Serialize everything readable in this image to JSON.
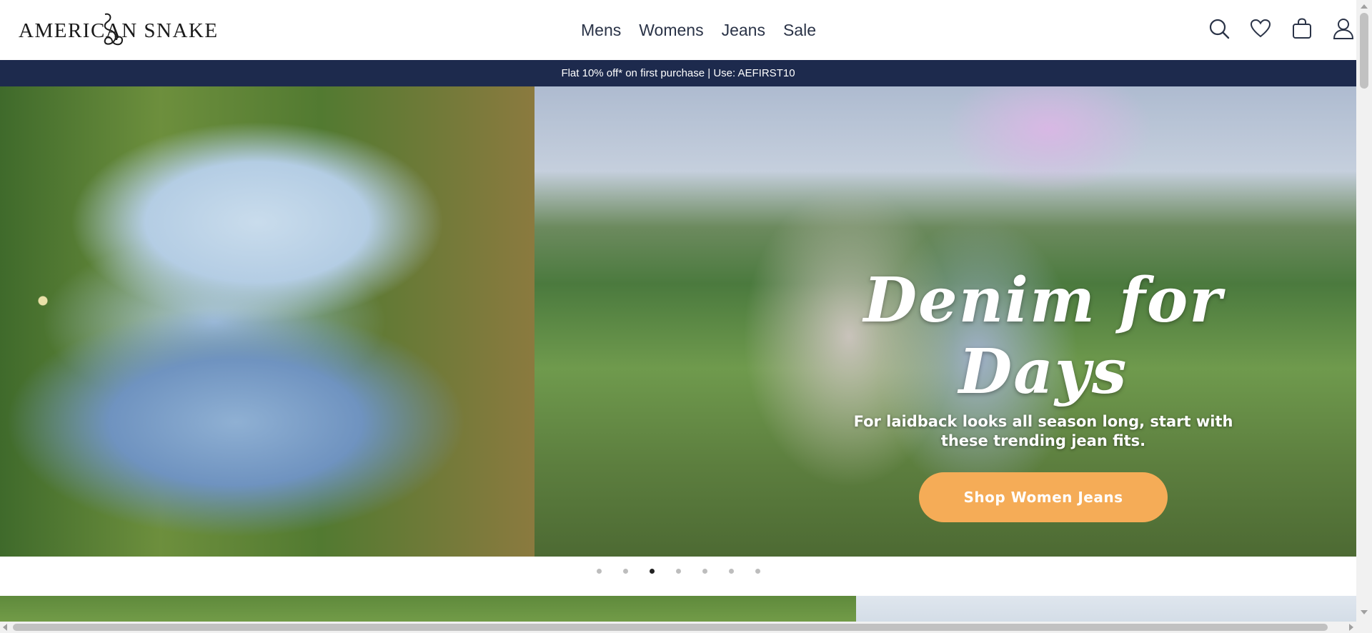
{
  "header": {
    "logo_text": "AMERICAN SNAKE",
    "nav": [
      {
        "label": "Mens"
      },
      {
        "label": "Womens"
      },
      {
        "label": "Jeans"
      },
      {
        "label": "Sale"
      }
    ],
    "icons": [
      "search-icon",
      "heart-icon",
      "bag-icon",
      "account-icon"
    ]
  },
  "promo": {
    "text": "Flat 10% off* on first purchase | Use: AEFIRST10"
  },
  "hero": {
    "title": "Denim for Days",
    "subtitle_line1": "For laidback looks all season long, start with",
    "subtitle_line2": "these trending jean fits.",
    "cta_label": "Shop Women Jeans"
  },
  "carousel": {
    "slide_count": 7,
    "active_index": 2
  },
  "colors": {
    "promo_bg": "#1d2a4d",
    "cta_bg": "#f5ac57",
    "text_dark": "#2a3347"
  }
}
